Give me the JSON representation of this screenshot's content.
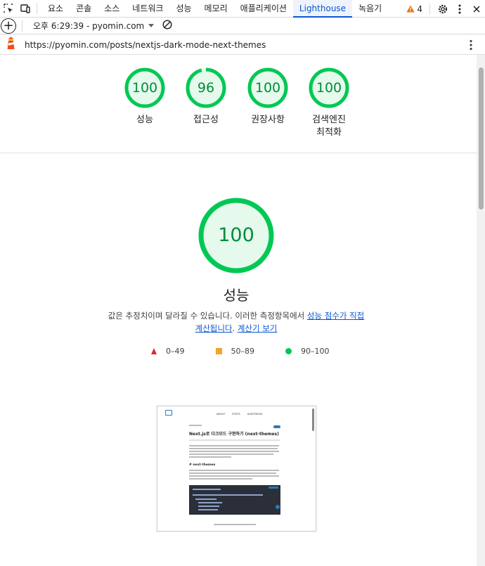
{
  "devtools": {
    "tabs": [
      "요소",
      "콘솔",
      "소스",
      "네트워크",
      "성능",
      "메모리",
      "애플리케이션",
      "Lighthouse",
      "녹음기"
    ],
    "active_tab": "Lighthouse",
    "issue_count": "4"
  },
  "toolbar": {
    "report_selector": "오후 6:29:39 - pyomin.com"
  },
  "report": {
    "url": "https://pyomin.com/posts/nextjs-dark-mode-next-themes"
  },
  "summary_gauges": [
    {
      "label": "성능",
      "score": "100",
      "value": 100
    },
    {
      "label": "접근성",
      "score": "96",
      "value": 96
    },
    {
      "label": "권장사항",
      "score": "100",
      "value": 100
    },
    {
      "label": "검색엔진\n최적화",
      "score": "100",
      "value": 100
    }
  ],
  "performance": {
    "score": "100",
    "value": 100,
    "title": "성능",
    "desc_text": "값은 추정치이며 달라질 수 있습니다. 이러한 측정항목에서 ",
    "desc_link1": "성능 점수가 직접 계산됩니다",
    "desc_mid": ". ",
    "desc_link2": "계산기 보기"
  },
  "legend": [
    {
      "shape": "triangle",
      "range": "0–49",
      "color": "#e3262a"
    },
    {
      "shape": "square",
      "range": "50–89",
      "color": "#f4a426"
    },
    {
      "shape": "circle",
      "range": "90–100",
      "color": "#00c853"
    }
  ],
  "thumbnail": {
    "nav_links": [
      "ABOUT",
      "POSTS",
      "GUESTBOOK"
    ],
    "post_title": "Next.js로 다크모드 구현하기 (next-themes)",
    "section_heading": "# next-themes"
  },
  "colors": {
    "pass_green": "#00c853",
    "pass_text": "#008c3c",
    "pass_fill": "#e5f9ec",
    "accent_blue": "#0b57d0"
  }
}
